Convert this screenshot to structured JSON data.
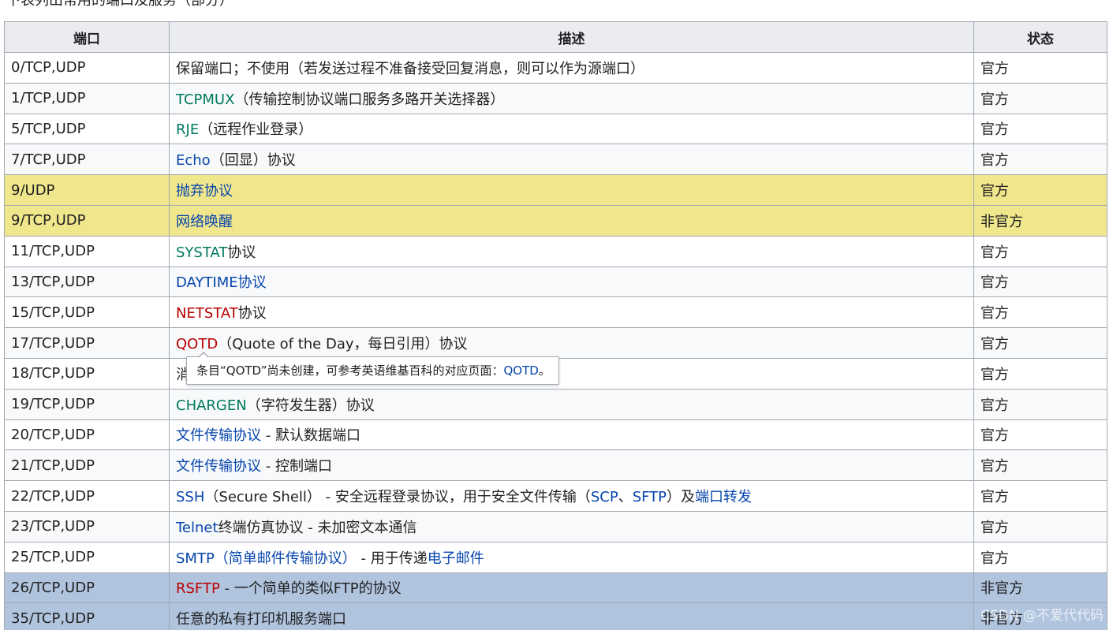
{
  "header_text": "下表列出常用的端口及服务（部分）",
  "table": {
    "headers": [
      "端口",
      "描述",
      "状态"
    ],
    "rows": [
      {
        "port": "0/TCP,UDP",
        "desc": [
          {
            "t": "保留端口；不使用（若发送过程不准备接受回复消息，则可以作为源端口）",
            "c": "dark"
          }
        ],
        "status": "官方"
      },
      {
        "port": "1/TCP,UDP",
        "desc": [
          {
            "t": "TCPMUX",
            "c": "green"
          },
          {
            "t": "（传输控制协议端口服务多路开关选择器）",
            "c": "dark"
          }
        ],
        "status": "官方"
      },
      {
        "port": "5/TCP,UDP",
        "desc": [
          {
            "t": "RJE",
            "c": "green"
          },
          {
            "t": "（远程作业登录）",
            "c": "dark"
          }
        ],
        "status": "官方"
      },
      {
        "port": "7/TCP,UDP",
        "desc": [
          {
            "t": "Echo",
            "c": "blue"
          },
          {
            "t": "（回显）协议",
            "c": "dark"
          }
        ],
        "status": "官方"
      },
      {
        "port": "9/UDP",
        "desc": [
          {
            "t": "抛弃协议",
            "c": "blue"
          }
        ],
        "status": "官方",
        "highlight": "yellow"
      },
      {
        "port": "9/TCP,UDP",
        "desc": [
          {
            "t": "网络唤醒",
            "c": "blue"
          }
        ],
        "status": "非官方",
        "highlight": "yellow"
      },
      {
        "port": "11/TCP,UDP",
        "desc": [
          {
            "t": "SYSTAT",
            "c": "green"
          },
          {
            "t": "协议",
            "c": "dark"
          }
        ],
        "status": "官方"
      },
      {
        "port": "13/TCP,UDP",
        "desc": [
          {
            "t": "DAYTIME协议",
            "c": "blue"
          }
        ],
        "status": "官方"
      },
      {
        "port": "15/TCP,UDP",
        "desc": [
          {
            "t": "NETSTAT",
            "c": "red"
          },
          {
            "t": "协议",
            "c": "dark"
          }
        ],
        "status": "官方"
      },
      {
        "port": "17/TCP,UDP",
        "desc": [
          {
            "t": "QOTD",
            "c": "red"
          },
          {
            "t": "（Quote of the Day，每日引用）协议",
            "c": "dark"
          }
        ],
        "status": "官方"
      },
      {
        "port": "18/TCP,UDP",
        "desc": [
          {
            "t": "消",
            "c": "dark"
          }
        ],
        "status": "官方"
      },
      {
        "port": "19/TCP,UDP",
        "desc": [
          {
            "t": "CHARGEN",
            "c": "green"
          },
          {
            "t": "（字符发生器）协议",
            "c": "dark"
          }
        ],
        "status": "官方"
      },
      {
        "port": "20/TCP,UDP",
        "desc": [
          {
            "t": "文件传输协议",
            "c": "blue"
          },
          {
            "t": " - 默认数据端口",
            "c": "dark"
          }
        ],
        "status": "官方"
      },
      {
        "port": "21/TCP,UDP",
        "desc": [
          {
            "t": "文件传输协议",
            "c": "blue"
          },
          {
            "t": " - 控制端口",
            "c": "dark"
          }
        ],
        "status": "官方"
      },
      {
        "port": "22/TCP,UDP",
        "desc": [
          {
            "t": "SSH",
            "c": "blue"
          },
          {
            "t": "（Secure Shell） - 安全远程登录协议，用于安全文件传输（",
            "c": "dark"
          },
          {
            "t": "SCP",
            "c": "blue"
          },
          {
            "t": "、",
            "c": "dark"
          },
          {
            "t": "SFTP",
            "c": "blue"
          },
          {
            "t": "）及",
            "c": "dark"
          },
          {
            "t": "端口转发",
            "c": "blue"
          }
        ],
        "status": "官方"
      },
      {
        "port": "23/TCP,UDP",
        "desc": [
          {
            "t": "Telnet",
            "c": "blue"
          },
          {
            "t": "终端仿真协议 - 未加密文本通信",
            "c": "dark"
          }
        ],
        "status": "官方"
      },
      {
        "port": "25/TCP,UDP",
        "desc": [
          {
            "t": "SMTP（简单邮件传输协议）",
            "c": "blue"
          },
          {
            "t": " - 用于传递",
            "c": "dark"
          },
          {
            "t": "电子邮件",
            "c": "blue"
          }
        ],
        "status": "官方"
      },
      {
        "port": "26/TCP,UDP",
        "desc": [
          {
            "t": "RSFTP",
            "c": "red"
          },
          {
            "t": " - 一个简单的类似FTP的协议",
            "c": "dark"
          }
        ],
        "status": "非官方",
        "highlight": "blue"
      },
      {
        "port": "35/TCP,UDP",
        "desc": [
          {
            "t": "任意的私有打印机服务端口",
            "c": "dark"
          }
        ],
        "status": "非官方",
        "highlight": "blue"
      }
    ]
  },
  "tooltip": {
    "text": "条目“QOTD”尚未创建，可参考英语维基百科的对应页面：",
    "link": "QOTD",
    "suffix": "。"
  },
  "watermark": "CSDN @不爱代代码",
  "colors": {
    "link_blue": "#0645ad",
    "link_green": "#00795f",
    "link_red": "#ba0000",
    "highlight_yellow": "#f0e68c",
    "highlight_blue": "#b0c4de",
    "header_bg": "#eaecf0",
    "border": "#a2a9b1"
  }
}
